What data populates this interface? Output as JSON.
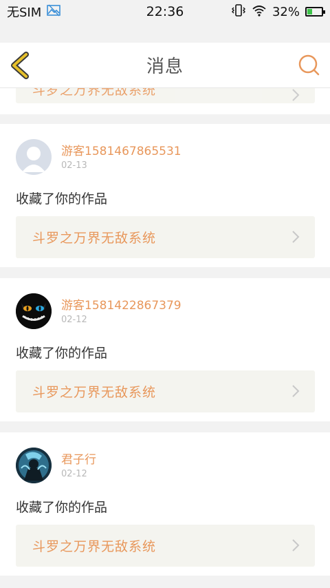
{
  "status_bar": {
    "carrier": "无SIM",
    "time": "22:36",
    "battery": "32%",
    "battery_level": 0.32
  },
  "header": {
    "title": "消息",
    "back_icon": "chevron-left-icon",
    "search_icon": "search-icon"
  },
  "partial_item": {
    "work_title": "斗罗之万界无敌系统"
  },
  "messages": [
    {
      "username": "游客1581467865531",
      "date": "02-13",
      "action": "收藏了你的作品",
      "work_title": "斗罗之万界无敌系统",
      "avatar": "guest-avatar"
    },
    {
      "username": "游客1581422867379",
      "date": "02-12",
      "action": "收藏了你的作品",
      "work_title": "斗罗之万界无敌系统",
      "avatar": "cat-avatar"
    },
    {
      "username": "君子行",
      "date": "02-12",
      "action": "收藏了你的作品",
      "work_title": "斗罗之万界无敌系统",
      "avatar": "character-avatar"
    }
  ],
  "colors": {
    "accent": "#e8975b",
    "back_arrow": "#e6c02a",
    "background": "#f2f2f2"
  }
}
